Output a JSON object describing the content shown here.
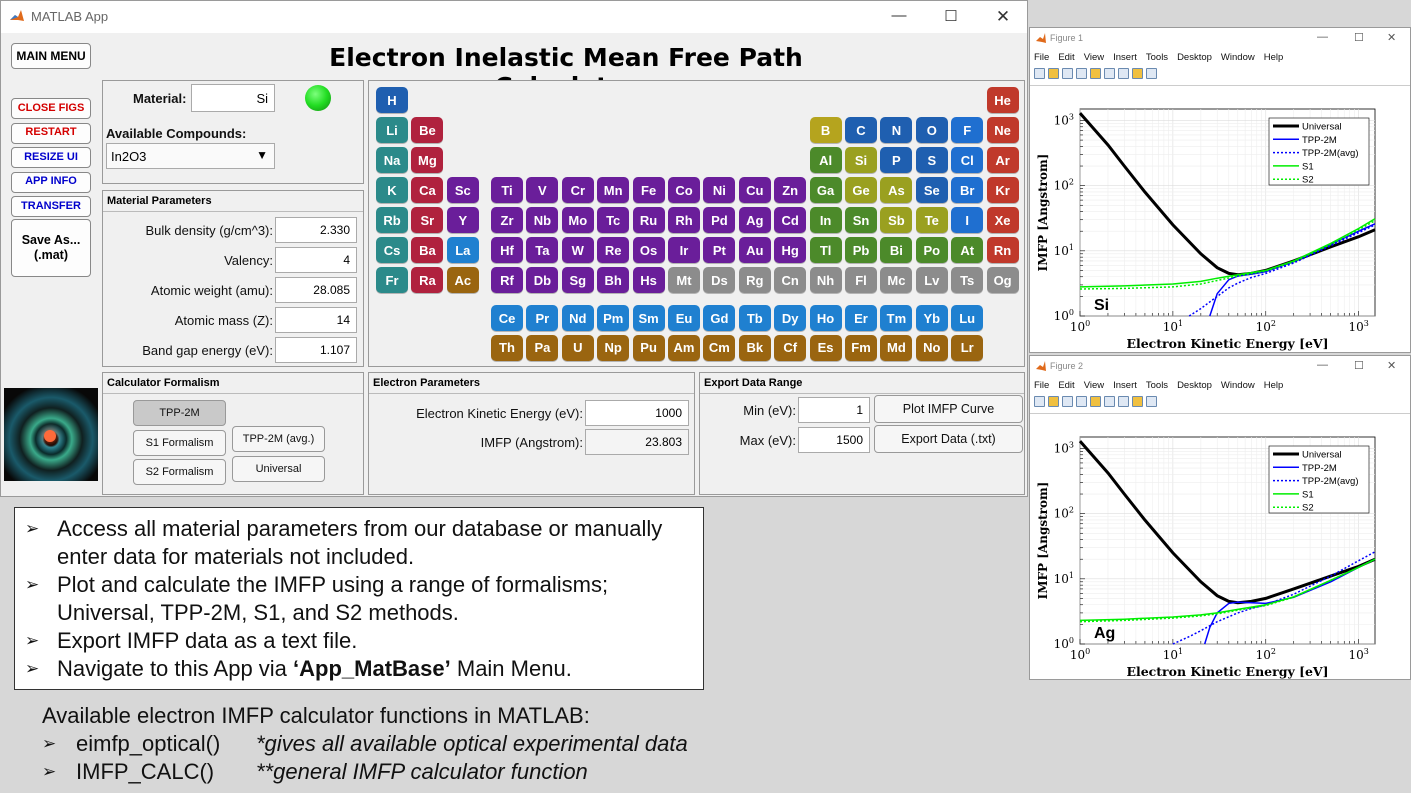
{
  "app": {
    "title": "MATLAB App",
    "heading": "Electron Inelastic Mean Free Path Calculator",
    "main_menu": "MAIN MENU",
    "side_buttons": [
      "CLOSE FIGS",
      "RESTART",
      "RESIZE UI",
      "APP INFO",
      "TRANSFER"
    ],
    "save_as": "Save As...\n(.mat)",
    "material_label": "Material:",
    "material_value": "Si",
    "compounds_label": "Available Compounds:",
    "compound_selected": "In2O3",
    "mat_params_title": "Material Parameters",
    "params": [
      {
        "label": "Bulk density (g/cm^3):",
        "value": "2.330"
      },
      {
        "label": "Valency:",
        "value": "4"
      },
      {
        "label": "Atomic weight (amu):",
        "value": "28.085"
      },
      {
        "label": "Atomic mass (Z):",
        "value": "14"
      },
      {
        "label": "Band gap energy (eV):",
        "value": "1.107"
      }
    ],
    "formalism_title": "Calculator Formalism",
    "formalisms": [
      "TPP-2M",
      "S1 Formalism",
      "S2 Formalism",
      "TPP-2M (avg.)",
      "Universal"
    ],
    "electron_title": "Electron Parameters",
    "eke_label": "Electron Kinetic Energy (eV):",
    "eke_value": "1000",
    "imfp_label": "IMFP (Angstrom):",
    "imfp_value": "23.803",
    "export_title": "Export Data Range",
    "min_label": "Min (eV):",
    "min_value": "1",
    "max_label": "Max (eV):",
    "max_value": "1500",
    "plot_btn": "Plot IMFP Curve",
    "export_btn": "Export Data (.txt)",
    "colors": {
      "accent_red": "#d40000",
      "accent_blue": "#0000cc",
      "status_led": "#22dd22"
    }
  },
  "elements": [
    {
      "s": "H",
      "c": "#1f5fb0",
      "r": 0,
      "g": 0
    },
    {
      "s": "He",
      "c": "#c0392b",
      "r": 0,
      "g": 17
    },
    {
      "s": "Li",
      "c": "#2b8a8a",
      "r": 1,
      "g": 0
    },
    {
      "s": "Be",
      "c": "#b0223e",
      "r": 1,
      "g": 1
    },
    {
      "s": "B",
      "c": "#b5a41e",
      "r": 1,
      "g": 12
    },
    {
      "s": "C",
      "c": "#1f5fb0",
      "r": 1,
      "g": 13
    },
    {
      "s": "N",
      "c": "#1f5fb0",
      "r": 1,
      "g": 14
    },
    {
      "s": "O",
      "c": "#1f5fb0",
      "r": 1,
      "g": 15
    },
    {
      "s": "F",
      "c": "#1f6fd0",
      "r": 1,
      "g": 16
    },
    {
      "s": "Ne",
      "c": "#c0392b",
      "r": 1,
      "g": 17
    },
    {
      "s": "Na",
      "c": "#2b8a8a",
      "r": 2,
      "g": 0
    },
    {
      "s": "Mg",
      "c": "#b0223e",
      "r": 2,
      "g": 1
    },
    {
      "s": "Al",
      "c": "#4c8a2a",
      "r": 2,
      "g": 12
    },
    {
      "s": "Si",
      "c": "#9aa020",
      "r": 2,
      "g": 13
    },
    {
      "s": "P",
      "c": "#1f5fb0",
      "r": 2,
      "g": 14
    },
    {
      "s": "S",
      "c": "#1f5fb0",
      "r": 2,
      "g": 15
    },
    {
      "s": "Cl",
      "c": "#1f6fd0",
      "r": 2,
      "g": 16
    },
    {
      "s": "Ar",
      "c": "#c0392b",
      "r": 2,
      "g": 17
    },
    {
      "s": "K",
      "c": "#2b8a8a",
      "r": 3,
      "g": 0
    },
    {
      "s": "Ca",
      "c": "#b0223e",
      "r": 3,
      "g": 1
    },
    {
      "s": "Sc",
      "c": "#6a1e9a",
      "r": 3,
      "g": 2
    },
    {
      "s": "Ti",
      "c": "#6a1e9a",
      "r": 3,
      "g": 3
    },
    {
      "s": "V",
      "c": "#6a1e9a",
      "r": 3,
      "g": 4
    },
    {
      "s": "Cr",
      "c": "#6a1e9a",
      "r": 3,
      "g": 5
    },
    {
      "s": "Mn",
      "c": "#6a1e9a",
      "r": 3,
      "g": 6
    },
    {
      "s": "Fe",
      "c": "#6a1e9a",
      "r": 3,
      "g": 7
    },
    {
      "s": "Co",
      "c": "#6a1e9a",
      "r": 3,
      "g": 8
    },
    {
      "s": "Ni",
      "c": "#6a1e9a",
      "r": 3,
      "g": 9
    },
    {
      "s": "Cu",
      "c": "#6a1e9a",
      "r": 3,
      "g": 10
    },
    {
      "s": "Zn",
      "c": "#6a1e9a",
      "r": 3,
      "g": 11
    },
    {
      "s": "Ga",
      "c": "#4c8a2a",
      "r": 3,
      "g": 12
    },
    {
      "s": "Ge",
      "c": "#9aa020",
      "r": 3,
      "g": 13
    },
    {
      "s": "As",
      "c": "#9aa020",
      "r": 3,
      "g": 14
    },
    {
      "s": "Se",
      "c": "#1f5fb0",
      "r": 3,
      "g": 15
    },
    {
      "s": "Br",
      "c": "#1f6fd0",
      "r": 3,
      "g": 16
    },
    {
      "s": "Kr",
      "c": "#c0392b",
      "r": 3,
      "g": 17
    },
    {
      "s": "Rb",
      "c": "#2b8a8a",
      "r": 4,
      "g": 0
    },
    {
      "s": "Sr",
      "c": "#b0223e",
      "r": 4,
      "g": 1
    },
    {
      "s": "Y",
      "c": "#6a1e9a",
      "r": 4,
      "g": 2
    },
    {
      "s": "Zr",
      "c": "#6a1e9a",
      "r": 4,
      "g": 3
    },
    {
      "s": "Nb",
      "c": "#6a1e9a",
      "r": 4,
      "g": 4
    },
    {
      "s": "Mo",
      "c": "#6a1e9a",
      "r": 4,
      "g": 5
    },
    {
      "s": "Tc",
      "c": "#6a1e9a",
      "r": 4,
      "g": 6
    },
    {
      "s": "Ru",
      "c": "#6a1e9a",
      "r": 4,
      "g": 7
    },
    {
      "s": "Rh",
      "c": "#6a1e9a",
      "r": 4,
      "g": 8
    },
    {
      "s": "Pd",
      "c": "#6a1e9a",
      "r": 4,
      "g": 9
    },
    {
      "s": "Ag",
      "c": "#6a1e9a",
      "r": 4,
      "g": 10
    },
    {
      "s": "Cd",
      "c": "#6a1e9a",
      "r": 4,
      "g": 11
    },
    {
      "s": "In",
      "c": "#4c8a2a",
      "r": 4,
      "g": 12
    },
    {
      "s": "Sn",
      "c": "#4c8a2a",
      "r": 4,
      "g": 13
    },
    {
      "s": "Sb",
      "c": "#9aa020",
      "r": 4,
      "g": 14
    },
    {
      "s": "Te",
      "c": "#9aa020",
      "r": 4,
      "g": 15
    },
    {
      "s": "I",
      "c": "#1f6fd0",
      "r": 4,
      "g": 16
    },
    {
      "s": "Xe",
      "c": "#c0392b",
      "r": 4,
      "g": 17
    },
    {
      "s": "Cs",
      "c": "#2b8a8a",
      "r": 5,
      "g": 0
    },
    {
      "s": "Ba",
      "c": "#b0223e",
      "r": 5,
      "g": 1
    },
    {
      "s": "La",
      "c": "#1f80d0",
      "r": 5,
      "g": 2
    },
    {
      "s": "Hf",
      "c": "#6a1e9a",
      "r": 5,
      "g": 3
    },
    {
      "s": "Ta",
      "c": "#6a1e9a",
      "r": 5,
      "g": 4
    },
    {
      "s": "W",
      "c": "#6a1e9a",
      "r": 5,
      "g": 5
    },
    {
      "s": "Re",
      "c": "#6a1e9a",
      "r": 5,
      "g": 6
    },
    {
      "s": "Os",
      "c": "#6a1e9a",
      "r": 5,
      "g": 7
    },
    {
      "s": "Ir",
      "c": "#6a1e9a",
      "r": 5,
      "g": 8
    },
    {
      "s": "Pt",
      "c": "#6a1e9a",
      "r": 5,
      "g": 9
    },
    {
      "s": "Au",
      "c": "#6a1e9a",
      "r": 5,
      "g": 10
    },
    {
      "s": "Hg",
      "c": "#6a1e9a",
      "r": 5,
      "g": 11
    },
    {
      "s": "Tl",
      "c": "#4c8a2a",
      "r": 5,
      "g": 12
    },
    {
      "s": "Pb",
      "c": "#4c8a2a",
      "r": 5,
      "g": 13
    },
    {
      "s": "Bi",
      "c": "#4c8a2a",
      "r": 5,
      "g": 14
    },
    {
      "s": "Po",
      "c": "#4c8a2a",
      "r": 5,
      "g": 15
    },
    {
      "s": "At",
      "c": "#4c8a2a",
      "r": 5,
      "g": 16
    },
    {
      "s": "Rn",
      "c": "#c0392b",
      "r": 5,
      "g": 17
    },
    {
      "s": "Fr",
      "c": "#2b8a8a",
      "r": 6,
      "g": 0
    },
    {
      "s": "Ra",
      "c": "#b0223e",
      "r": 6,
      "g": 1
    },
    {
      "s": "Ac",
      "c": "#9a6510",
      "r": 6,
      "g": 2
    },
    {
      "s": "Rf",
      "c": "#6a1e9a",
      "r": 6,
      "g": 3
    },
    {
      "s": "Db",
      "c": "#6a1e9a",
      "r": 6,
      "g": 4
    },
    {
      "s": "Sg",
      "c": "#6a1e9a",
      "r": 6,
      "g": 5
    },
    {
      "s": "Bh",
      "c": "#6a1e9a",
      "r": 6,
      "g": 6
    },
    {
      "s": "Hs",
      "c": "#6a1e9a",
      "r": 6,
      "g": 7
    },
    {
      "s": "Mt",
      "c": "#8c8c8c",
      "r": 6,
      "g": 8
    },
    {
      "s": "Ds",
      "c": "#8c8c8c",
      "r": 6,
      "g": 9
    },
    {
      "s": "Rg",
      "c": "#8c8c8c",
      "r": 6,
      "g": 10
    },
    {
      "s": "Cn",
      "c": "#8c8c8c",
      "r": 6,
      "g": 11
    },
    {
      "s": "Nh",
      "c": "#8c8c8c",
      "r": 6,
      "g": 12
    },
    {
      "s": "Fl",
      "c": "#8c8c8c",
      "r": 6,
      "g": 13
    },
    {
      "s": "Mc",
      "c": "#8c8c8c",
      "r": 6,
      "g": 14
    },
    {
      "s": "Lv",
      "c": "#8c8c8c",
      "r": 6,
      "g": 15
    },
    {
      "s": "Ts",
      "c": "#8c8c8c",
      "r": 6,
      "g": 16
    },
    {
      "s": "Og",
      "c": "#8c8c8c",
      "r": 6,
      "g": 17
    },
    {
      "s": "Ce",
      "c": "#1f80d0",
      "r": 7,
      "g": 3
    },
    {
      "s": "Pr",
      "c": "#1f80d0",
      "r": 7,
      "g": 4
    },
    {
      "s": "Nd",
      "c": "#1f80d0",
      "r": 7,
      "g": 5
    },
    {
      "s": "Pm",
      "c": "#1f80d0",
      "r": 7,
      "g": 6
    },
    {
      "s": "Sm",
      "c": "#1f80d0",
      "r": 7,
      "g": 7
    },
    {
      "s": "Eu",
      "c": "#1f80d0",
      "r": 7,
      "g": 8
    },
    {
      "s": "Gd",
      "c": "#1f80d0",
      "r": 7,
      "g": 9
    },
    {
      "s": "Tb",
      "c": "#1f80d0",
      "r": 7,
      "g": 10
    },
    {
      "s": "Dy",
      "c": "#1f80d0",
      "r": 7,
      "g": 11
    },
    {
      "s": "Ho",
      "c": "#1f80d0",
      "r": 7,
      "g": 12
    },
    {
      "s": "Er",
      "c": "#1f80d0",
      "r": 7,
      "g": 13
    },
    {
      "s": "Tm",
      "c": "#1f80d0",
      "r": 7,
      "g": 14
    },
    {
      "s": "Yb",
      "c": "#1f80d0",
      "r": 7,
      "g": 15
    },
    {
      "s": "Lu",
      "c": "#1f80d0",
      "r": 7,
      "g": 16
    },
    {
      "s": "Th",
      "c": "#9a6510",
      "r": 8,
      "g": 3
    },
    {
      "s": "Pa",
      "c": "#9a6510",
      "r": 8,
      "g": 4
    },
    {
      "s": "U",
      "c": "#9a6510",
      "r": 8,
      "g": 5
    },
    {
      "s": "Np",
      "c": "#9a6510",
      "r": 8,
      "g": 6
    },
    {
      "s": "Pu",
      "c": "#9a6510",
      "r": 8,
      "g": 7
    },
    {
      "s": "Am",
      "c": "#9a6510",
      "r": 8,
      "g": 8
    },
    {
      "s": "Cm",
      "c": "#9a6510",
      "r": 8,
      "g": 9
    },
    {
      "s": "Bk",
      "c": "#9a6510",
      "r": 8,
      "g": 10
    },
    {
      "s": "Cf",
      "c": "#9a6510",
      "r": 8,
      "g": 11
    },
    {
      "s": "Es",
      "c": "#9a6510",
      "r": 8,
      "g": 12
    },
    {
      "s": "Fm",
      "c": "#9a6510",
      "r": 8,
      "g": 13
    },
    {
      "s": "Md",
      "c": "#9a6510",
      "r": 8,
      "g": 14
    },
    {
      "s": "No",
      "c": "#9a6510",
      "r": 8,
      "g": 15
    },
    {
      "s": "Lr",
      "c": "#9a6510",
      "r": 8,
      "g": 16
    }
  ],
  "bullets": [
    "Access all material parameters from our database or manually enter data for materials not included.",
    "Plot and calculate the IMFP using a range of formalisms; Universal, TPP-2M, S1, and S2 methods.",
    "Export IMFP data as a text file."
  ],
  "bullet4": {
    "pre": "Navigate to this App via ",
    "bold": "‘App_MatBase’",
    "post": " Main Menu."
  },
  "info": {
    "heading": "Available electron IMFP calculator functions in MATLAB:",
    "functions": [
      {
        "name": "eimfp_optical()",
        "note": "*gives all available optical experimental data"
      },
      {
        "name": "IMFP_CALC()",
        "note": "**general IMFP calculator function"
      }
    ]
  },
  "figure_menu": [
    "File",
    "Edit",
    "View",
    "Insert",
    "Tools",
    "Desktop",
    "Window",
    "Help"
  ],
  "chart_data": [
    {
      "type": "line",
      "window_title": "Figure 1",
      "annotation": "Si",
      "xlabel": "Electron Kinetic Energy [eV]",
      "ylabel": "IMFP [Angstrom]",
      "xscale": "log",
      "yscale": "log",
      "xlim": [
        1,
        1500
      ],
      "ylim": [
        1,
        1500
      ],
      "grid": true,
      "legend_position": "top-right",
      "series": [
        {
          "name": "Universal",
          "color": "#000000",
          "style": "solid",
          "width": 3,
          "x": [
            1,
            2,
            3,
            5,
            10,
            20,
            30,
            40,
            50,
            70,
            100,
            200,
            500,
            1000,
            1500
          ],
          "y": [
            1300,
            420,
            200,
            80,
            25,
            9,
            5.5,
            4.5,
            4.3,
            4.5,
            5,
            7,
            11.5,
            16.5,
            21
          ]
        },
        {
          "name": "TPP-2M",
          "color": "#0000ff",
          "style": "solid",
          "width": 1.5,
          "x": [
            25,
            30,
            40,
            50,
            70,
            100,
            200,
            500,
            1000,
            1500
          ],
          "y": [
            1,
            2.2,
            3.6,
            4.1,
            4.4,
            4.8,
            6.8,
            12.5,
            20,
            26
          ]
        },
        {
          "name": "TPP-2M(avg)",
          "color": "#0000ff",
          "style": "dotted",
          "width": 1.5,
          "x": [
            15,
            20,
            30,
            40,
            50,
            70,
            100,
            200,
            500,
            1000,
            1500
          ],
          "y": [
            1,
            1.3,
            2,
            2.7,
            3.2,
            3.9,
            4.5,
            6.5,
            12,
            19,
            25
          ]
        },
        {
          "name": "S1",
          "color": "#00ee00",
          "style": "solid",
          "width": 1.5,
          "x": [
            1,
            3,
            10,
            20,
            30,
            50,
            100,
            200,
            500,
            1000,
            1500
          ],
          "y": [
            2.8,
            2.9,
            3.1,
            3.4,
            3.8,
            4.3,
            5,
            7,
            13,
            22,
            31
          ]
        },
        {
          "name": "S2",
          "color": "#00ee00",
          "style": "dotted",
          "width": 1.5,
          "x": [
            1,
            3,
            10,
            20,
            30,
            50,
            100,
            200,
            500,
            1000,
            1500
          ],
          "y": [
            2.6,
            2.65,
            2.8,
            3.1,
            3.5,
            4.1,
            4.9,
            6.8,
            12.5,
            21,
            29
          ]
        }
      ]
    },
    {
      "type": "line",
      "window_title": "Figure 2",
      "annotation": "Ag",
      "xlabel": "Electron Kinetic Energy [eV]",
      "ylabel": "IMFP [Angstrom]",
      "xscale": "log",
      "yscale": "log",
      "xlim": [
        1,
        1500
      ],
      "ylim": [
        1,
        1500
      ],
      "grid": true,
      "legend_position": "top-right",
      "series": [
        {
          "name": "Universal",
          "color": "#000000",
          "style": "solid",
          "width": 3,
          "x": [
            1,
            2,
            3,
            5,
            10,
            20,
            30,
            40,
            50,
            70,
            100,
            200,
            500,
            1000,
            1500
          ],
          "y": [
            1300,
            420,
            200,
            80,
            25,
            9,
            5.5,
            4.5,
            4.3,
            4.5,
            5,
            7,
            11,
            15.5,
            20
          ]
        },
        {
          "name": "TPP-2M",
          "color": "#0000ff",
          "style": "solid",
          "width": 1.5,
          "x": [
            22,
            25,
            30,
            40,
            50,
            70,
            100,
            200,
            500,
            1000,
            1500
          ],
          "y": [
            1,
            1.8,
            3,
            4.2,
            4.4,
            4.3,
            4.2,
            5.2,
            9,
            15,
            20
          ]
        },
        {
          "name": "TPP-2M(avg)",
          "color": "#0000ff",
          "style": "dotted",
          "width": 1.5,
          "x": [
            10,
            15,
            20,
            30,
            50,
            70,
            100,
            200,
            500,
            1000,
            1500
          ],
          "y": [
            1,
            1.3,
            1.6,
            2.2,
            3,
            3.5,
            4,
            5.8,
            11,
            19,
            26
          ]
        },
        {
          "name": "S1",
          "color": "#00ee00",
          "style": "solid",
          "width": 1.5,
          "x": [
            1,
            3,
            10,
            20,
            30,
            50,
            100,
            200,
            500,
            1000,
            1500
          ],
          "y": [
            2.3,
            2.4,
            2.6,
            2.8,
            3,
            3.4,
            4,
            5.3,
            9.5,
            15,
            20
          ]
        },
        {
          "name": "S2",
          "color": "#00ee00",
          "style": "dotted",
          "width": 1.5,
          "x": [
            1,
            3,
            10,
            20,
            30,
            50,
            100,
            200,
            500,
            1000,
            1500
          ],
          "y": [
            2.2,
            2.3,
            2.5,
            2.7,
            2.9,
            3.3,
            3.9,
            5.2,
            9.5,
            15,
            20
          ]
        }
      ]
    }
  ]
}
